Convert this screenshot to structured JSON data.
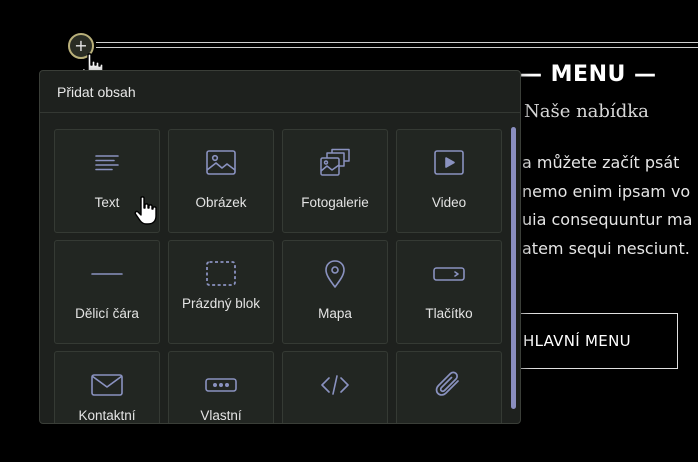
{
  "background": {
    "heading": "— MENU —",
    "subheading": "Naše nabídka",
    "paragraph_lines": [
      "a můžete začít psát",
      "nemo enim ipsam vo",
      "uia consequuntur ma",
      "atem sequi nesciunt."
    ],
    "button_label": "HLAVNÍ MENU"
  },
  "insert_control": {
    "plus_symbol": "+"
  },
  "panel": {
    "title": "Přidat obsah",
    "tiles": [
      {
        "label": "Text",
        "icon": "text-lines-icon"
      },
      {
        "label": "Obrázek",
        "icon": "image-icon"
      },
      {
        "label": "Fotogalerie",
        "icon": "gallery-icon"
      },
      {
        "label": "Video",
        "icon": "video-play-icon"
      },
      {
        "label": "Dělicí čára",
        "icon": "divider-line-icon"
      },
      {
        "label": "Prázdný blok",
        "icon": "dashed-block-icon"
      },
      {
        "label": "Mapa",
        "icon": "map-pin-icon"
      },
      {
        "label": "Tlačítko",
        "icon": "button-shape-icon"
      },
      {
        "label": "Kontaktní",
        "icon": "envelope-icon"
      },
      {
        "label": "Vlastní",
        "icon": "custom-dots-icon"
      },
      {
        "label": "",
        "icon": "code-icon"
      },
      {
        "label": "",
        "icon": "paperclip-icon"
      }
    ]
  },
  "colors": {
    "icon_stroke": "#8a92c0",
    "panel_bg": "#1e211e",
    "tile_bg": "#222622",
    "scrollbar": "#8a8ec0"
  }
}
